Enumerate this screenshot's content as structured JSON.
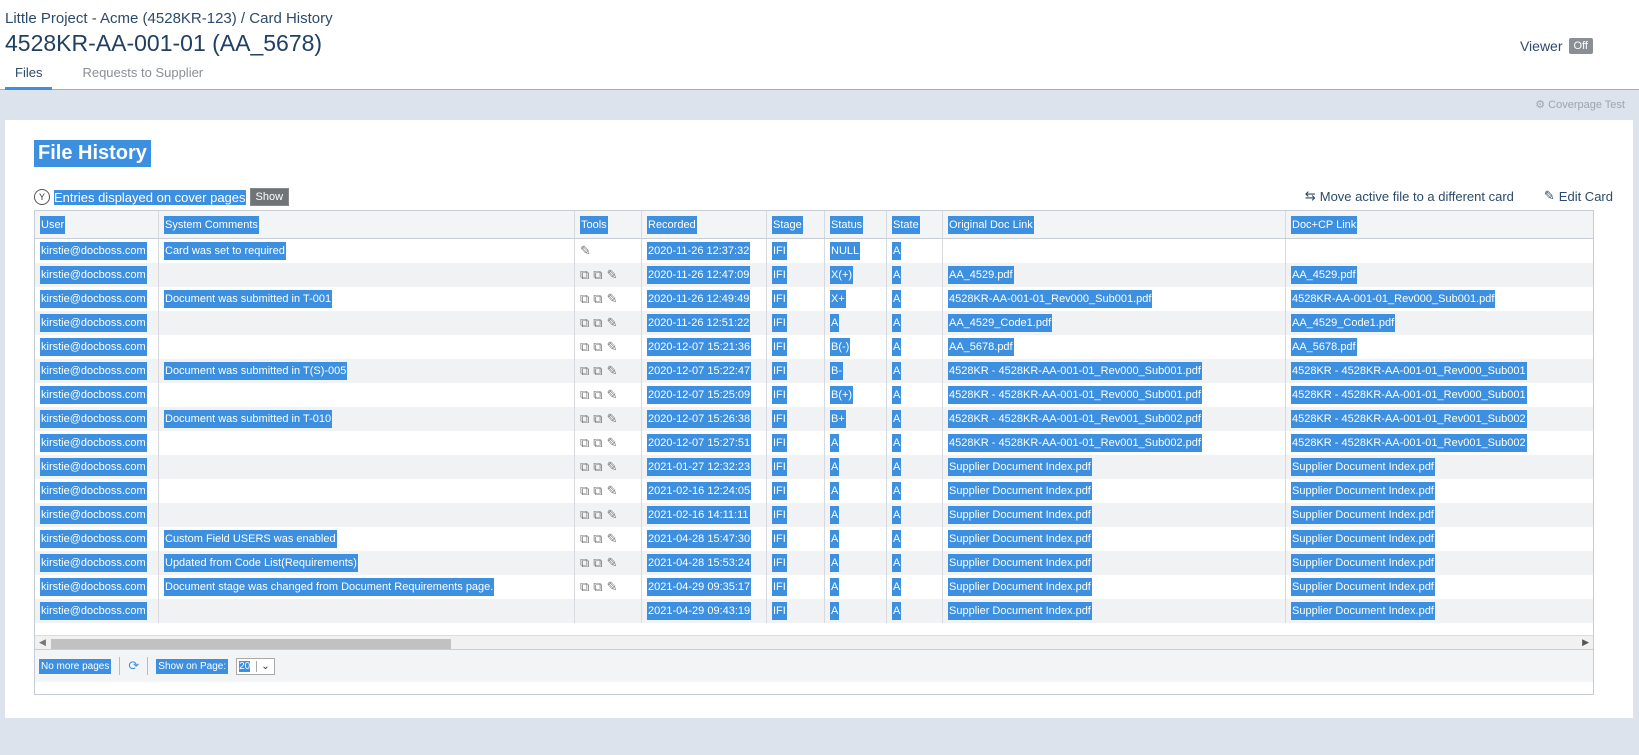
{
  "header": {
    "breadcrumb": "Little Project - Acme (4528KR-123) / Card History",
    "title": "4528KR-AA-001-01 (AA_5678)",
    "viewer_label": "Viewer",
    "viewer_toggle": "Off",
    "tabs": [
      "Files",
      "Requests to Supplier"
    ],
    "coverpage_test": "Coverpage Test"
  },
  "panel": {
    "title": "File History",
    "entries_icon": "Y",
    "entries_label": "Entries displayed on cover pages",
    "show_button": "Show",
    "move_file": "Move active file to a different card",
    "edit_card": "Edit Card"
  },
  "table": {
    "columns": [
      "User",
      "System Comments",
      "Tools",
      "Recorded",
      "Stage",
      "Status",
      "State",
      "Original Doc Link",
      "Doc+CP Link"
    ],
    "rows": [
      {
        "user": "kirstie@docboss.com",
        "comment": "Card was set to required",
        "recorded": "2020-11-26 12:37:32",
        "stage": "IFI",
        "status": "NULL",
        "state": "A",
        "orig": "",
        "cp": ""
      },
      {
        "user": "kirstie@docboss.com",
        "comment": "",
        "recorded": "2020-11-26 12:47:09",
        "stage": "IFI",
        "status": "X(+)",
        "state": "A",
        "orig": "AA_4529.pdf",
        "cp": "AA_4529.pdf"
      },
      {
        "user": "kirstie@docboss.com",
        "comment": "Document was submitted in T-001",
        "recorded": "2020-11-26 12:49:49",
        "stage": "IFI",
        "status": "X+",
        "state": "A",
        "orig": "4528KR-AA-001-01_Rev000_Sub001.pdf",
        "cp": "4528KR-AA-001-01_Rev000_Sub001.pdf"
      },
      {
        "user": "kirstie@docboss.com",
        "comment": "",
        "recorded": "2020-11-26 12:51:22",
        "stage": "IFI",
        "status": "A",
        "state": "A",
        "orig": "AA_4529_Code1.pdf",
        "cp": "AA_4529_Code1.pdf"
      },
      {
        "user": "kirstie@docboss.com",
        "comment": "",
        "recorded": "2020-12-07 15:21:36",
        "stage": "IFI",
        "status": "B(-)",
        "state": "A",
        "orig": "AA_5678.pdf",
        "cp": "AA_5678.pdf"
      },
      {
        "user": "kirstie@docboss.com",
        "comment": "Document was submitted in T(S)-005",
        "recorded": "2020-12-07 15:22:47",
        "stage": "IFI",
        "status": "B-",
        "state": "A",
        "orig": "4528KR - 4528KR-AA-001-01_Rev000_Sub001.pdf",
        "cp": "4528KR - 4528KR-AA-001-01_Rev000_Sub001"
      },
      {
        "user": "kirstie@docboss.com",
        "comment": "",
        "recorded": "2020-12-07 15:25:09",
        "stage": "IFI",
        "status": "B(+)",
        "state": "A",
        "orig": "4528KR - 4528KR-AA-001-01_Rev000_Sub001.pdf",
        "cp": "4528KR - 4528KR-AA-001-01_Rev000_Sub001"
      },
      {
        "user": "kirstie@docboss.com",
        "comment": "Document was submitted in T-010",
        "recorded": "2020-12-07 15:26:38",
        "stage": "IFI",
        "status": "B+",
        "state": "A",
        "orig": "4528KR - 4528KR-AA-001-01_Rev001_Sub002.pdf",
        "cp": "4528KR - 4528KR-AA-001-01_Rev001_Sub002"
      },
      {
        "user": "kirstie@docboss.com",
        "comment": "",
        "recorded": "2020-12-07 15:27:51",
        "stage": "IFI",
        "status": "A",
        "state": "A",
        "orig": "4528KR - 4528KR-AA-001-01_Rev001_Sub002.pdf",
        "cp": "4528KR - 4528KR-AA-001-01_Rev001_Sub002"
      },
      {
        "user": "kirstie@docboss.com",
        "comment": "",
        "recorded": "2021-01-27 12:32:23",
        "stage": "IFI",
        "status": "A",
        "state": "A",
        "orig": "Supplier Document Index.pdf",
        "cp": "Supplier Document Index.pdf"
      },
      {
        "user": "kirstie@docboss.com",
        "comment": "",
        "recorded": "2021-02-16 12:24:05",
        "stage": "IFI",
        "status": "A",
        "state": "A",
        "orig": "Supplier Document Index.pdf",
        "cp": "Supplier Document Index.pdf"
      },
      {
        "user": "kirstie@docboss.com",
        "comment": "",
        "recorded": "2021-02-16 14:11:11",
        "stage": "IFI",
        "status": "A",
        "state": "A",
        "orig": "Supplier Document Index.pdf",
        "cp": "Supplier Document Index.pdf"
      },
      {
        "user": "kirstie@docboss.com",
        "comment": "Custom Field USERS was enabled",
        "recorded": "2021-04-28 15:47:30",
        "stage": "IFI",
        "status": "A",
        "state": "A",
        "orig": "Supplier Document Index.pdf",
        "cp": "Supplier Document Index.pdf"
      },
      {
        "user": "kirstie@docboss.com",
        "comment": "Updated from Code List(Requirements)",
        "recorded": "2021-04-28 15:53:24",
        "stage": "IFI",
        "status": "A",
        "state": "A",
        "orig": "Supplier Document Index.pdf",
        "cp": "Supplier Document Index.pdf"
      },
      {
        "user": "kirstie@docboss.com",
        "comment": "Document stage was changed from Document Requirements page.",
        "recorded": "2021-04-29 09:35:17",
        "stage": "IFI",
        "status": "A",
        "state": "A",
        "orig": "Supplier Document Index.pdf",
        "cp": "Supplier Document Index.pdf"
      },
      {
        "user": "kirstie@docboss.com",
        "comment": "",
        "recorded": "2021-04-29 09:43:19",
        "stage": "IFI",
        "status": "A",
        "state": "A",
        "orig": "Supplier Document Index.pdf",
        "cp": "Supplier Document Index.pdf"
      }
    ]
  },
  "footer": {
    "no_more_pages": "No more pages",
    "show_on_page": "Show on Page:",
    "page_size": "20"
  },
  "colors": {
    "selection": "#3d8fe0",
    "title": "#1f3f63",
    "background": "#dde3ec"
  }
}
